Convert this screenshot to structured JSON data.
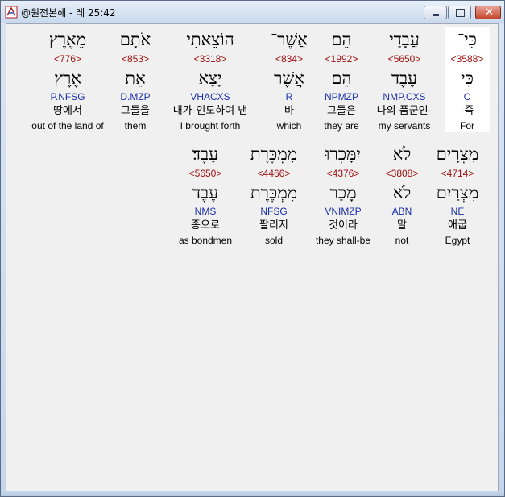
{
  "window": {
    "title": "@원전본해 - 레 25:42",
    "close_glyph": "✕"
  },
  "verse": [
    {
      "heb": "כִּי־",
      "strong": "<3588>",
      "lemma": "כִּי",
      "morph": "C",
      "kor": "-즉",
      "eng": "For",
      "highlight": true
    },
    {
      "heb": "עֲבָדַי",
      "strong": "<5650>",
      "lemma": "עֶבֶד",
      "morph": "NMP.CXS",
      "kor": "나의 품군인-",
      "eng": "my servants",
      "highlight": false
    },
    {
      "heb": "הֵם",
      "strong": "<1992>",
      "lemma": "הֵם",
      "morph": "NPMZP",
      "kor": "그들은",
      "eng": "they are",
      "highlight": false
    },
    {
      "heb": "אֲשֶׁר־",
      "strong": "<834>",
      "lemma": "אֲשֶׁר",
      "morph": "R",
      "kor": "바",
      "eng": "which",
      "highlight": false
    },
    {
      "heb": "הוֹצֵאתִי",
      "strong": "<3318>",
      "lemma": "יָצָא",
      "morph": "VHACXS",
      "kor": "내가-인도하여 낸",
      "eng": "I brought forth",
      "highlight": false
    },
    {
      "heb": "אֹתָם",
      "strong": "<853>",
      "lemma": "אֵת",
      "morph": "D.MZP",
      "kor": "그들을",
      "eng": "them",
      "highlight": false
    },
    {
      "heb": "מֵאֶרֶץ",
      "strong": "<776>",
      "lemma": "אֶרֶץ",
      "morph": "P.NFSG",
      "kor": "땅에서",
      "eng": "out of the land of",
      "highlight": false
    },
    {
      "heb": "מִצְרָיִם",
      "strong": "<4714>",
      "lemma": "מִצְרַיִם",
      "morph": "NE",
      "kor": "애굽",
      "eng": "Egypt",
      "highlight": false
    },
    {
      "heb": "לֹא",
      "strong": "<3808>",
      "lemma": "לֹא",
      "morph": "ABN",
      "kor": "말",
      "eng": "not",
      "highlight": false
    },
    {
      "heb": "יִמָּכְרוּ",
      "strong": "<4376>",
      "lemma": "מָכַר",
      "morph": "VNIMZP",
      "kor": "것이라",
      "eng": "they shall-be",
      "highlight": false
    },
    {
      "heb": "מִמְכֶּרֶת",
      "strong": "<4466>",
      "lemma": "מִמְכֶּרֶת",
      "morph": "NFSG",
      "kor": "팔리지",
      "eng": "sold",
      "highlight": false
    },
    {
      "heb": "עָבֶד׃",
      "strong": "<5650>",
      "lemma": "עֶבֶד",
      "morph": "NMS",
      "kor": "종으로",
      "eng": "as bondmen",
      "highlight": false
    }
  ]
}
